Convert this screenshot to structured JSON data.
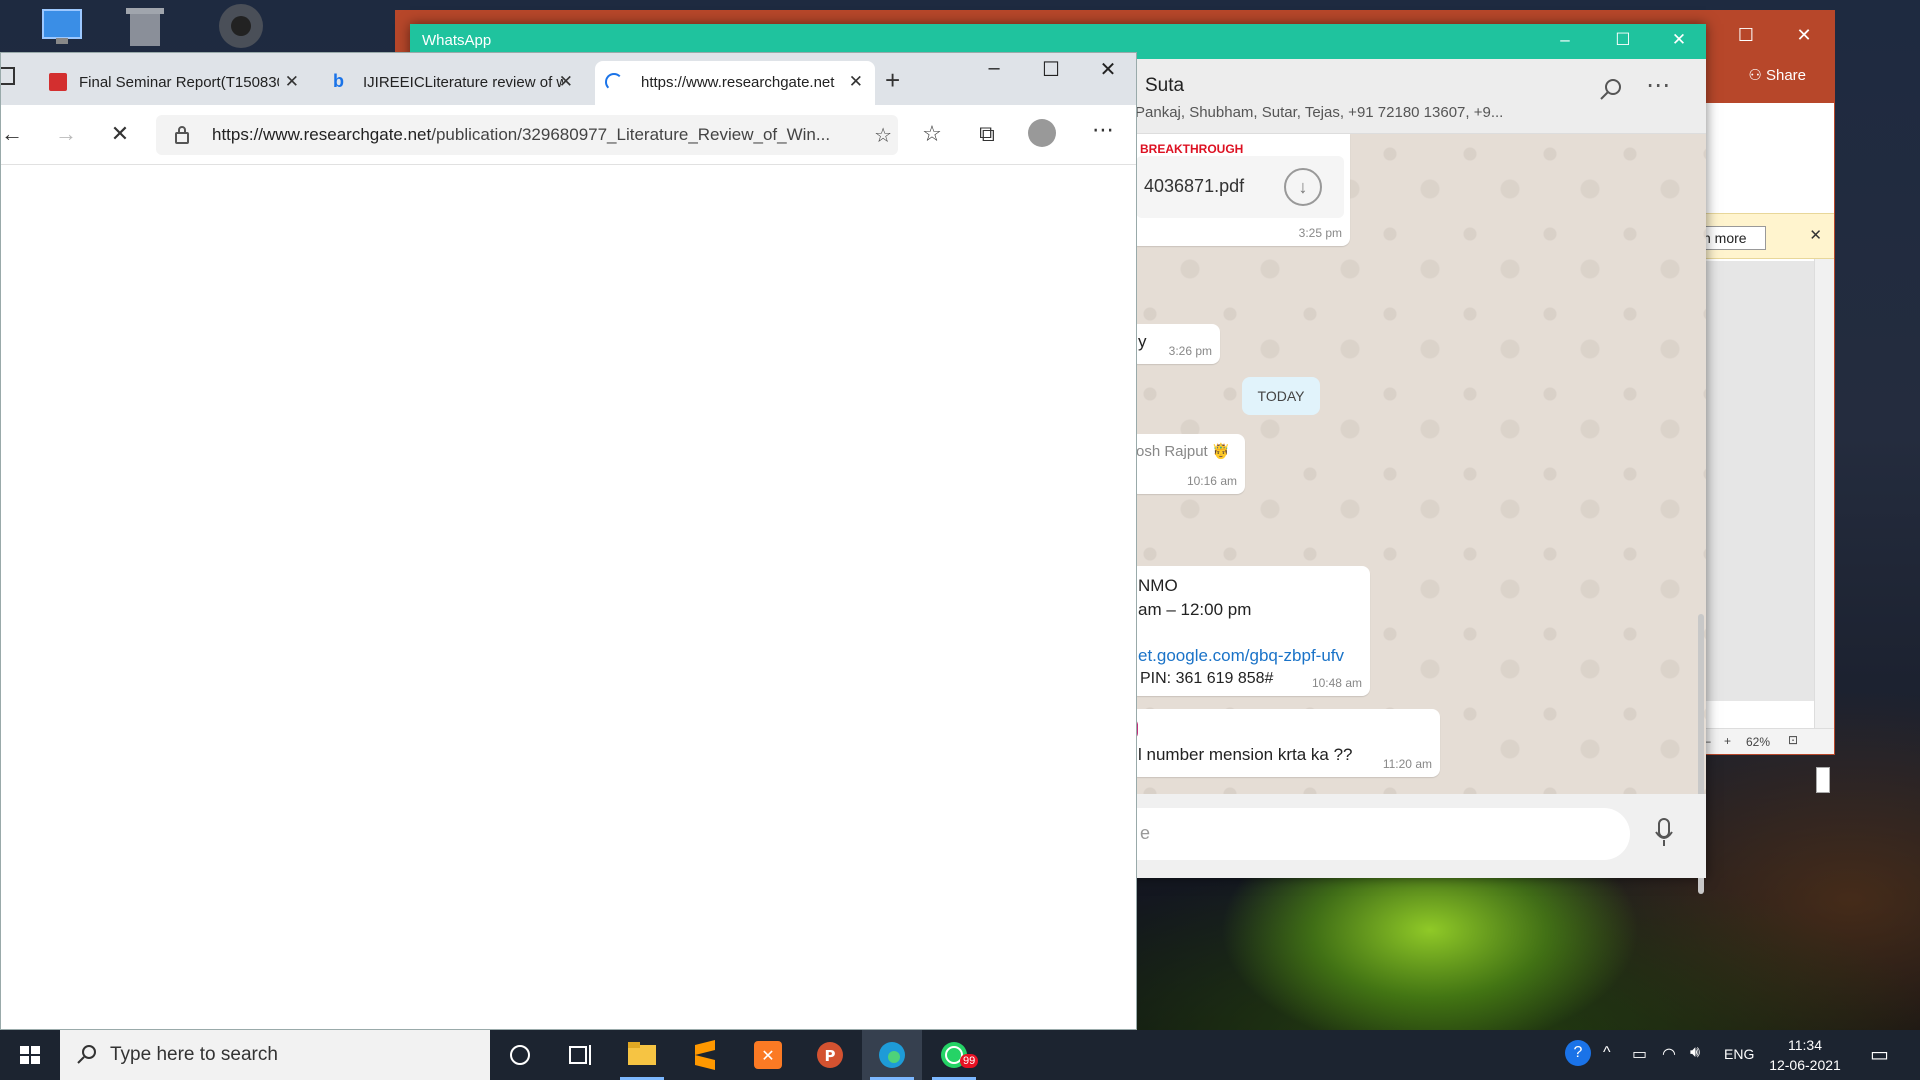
{
  "powerpoint": {
    "share_label": "Share",
    "learn_more_label": "n more",
    "zoom": "62%"
  },
  "whatsapp": {
    "title": "WhatsApp",
    "chat_name": "Suta",
    "participants": "Pankaj, Shubham, Sutar, Tejas, +91 72180 13607, +9...",
    "input_placeholder": "e",
    "messages": [
      {
        "text": "BREAKTHROUGH",
        "file": "4036871.pdf",
        "time": "3:25 pm"
      },
      {
        "text": "y",
        "time": "3:26 pm"
      },
      {
        "sender": "osh Rajput 🤴",
        "time": "10:16 am"
      },
      {
        "line1": "NMO",
        "line2": "am – 12:00 pm",
        "link": "et.google.com/gbq-zbpf-ufv",
        "pin": "PIN: 361 619 858#",
        "time": "10:48 am"
      },
      {
        "text": "l number mension krta ka ??",
        "time": "11:20 am"
      }
    ],
    "date_divider": "TODAY"
  },
  "edge": {
    "tabs": [
      {
        "label": "Final Seminar Report(T150830",
        "icon": "pdf-icon"
      },
      {
        "label": "IJIREEICLiterature review of w",
        "icon": "bing-icon"
      },
      {
        "label": "https://www.researchgate.net",
        "icon": "loading-icon"
      }
    ],
    "url_host": "https://www.researchgate.net",
    "url_path": "/publication/329680977_Literature_Review_of_Win..."
  },
  "taskbar": {
    "search_placeholder": "Type here to search",
    "whatsapp_badge": "99",
    "language": "ENG",
    "time": "11:34",
    "date": "12-06-2021"
  },
  "colors": {
    "whatsapp_teal": "#1fc39e",
    "powerpoint_red": "#b7472a",
    "taskbar": "#1c2430"
  }
}
